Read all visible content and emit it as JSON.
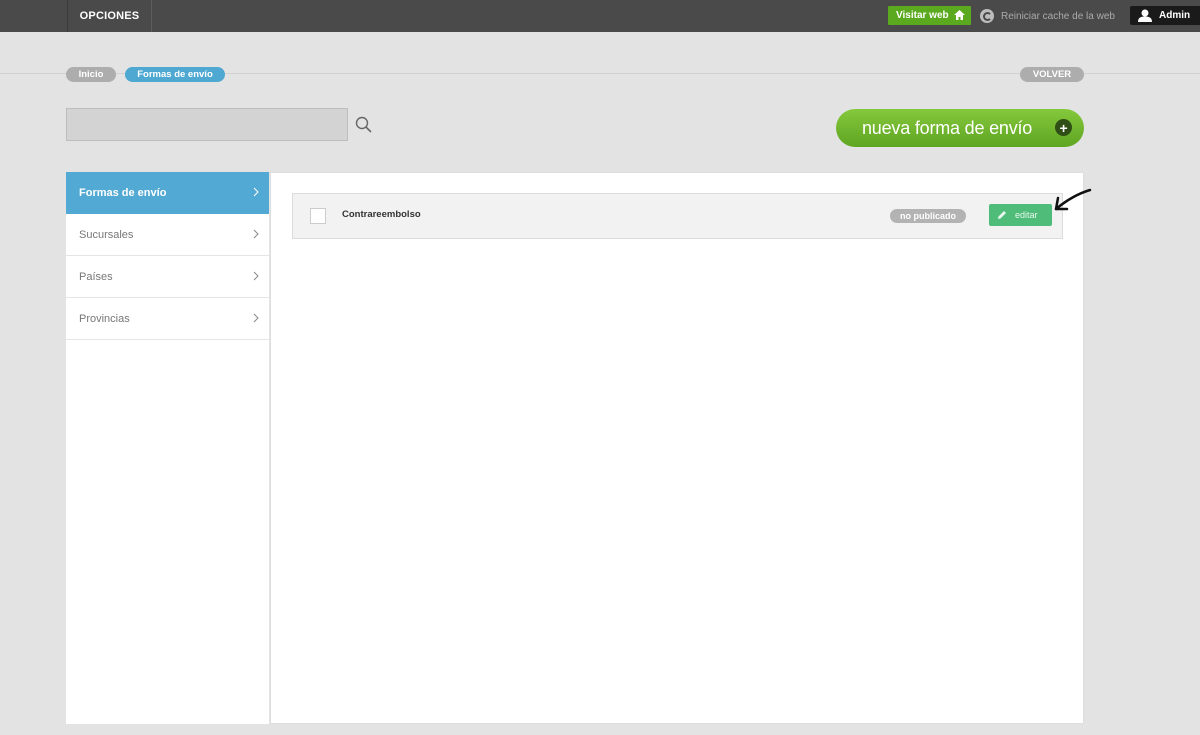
{
  "topbar": {
    "menu_label": "OPCIONES",
    "visit_label": "Visitar web",
    "cache_label": "Reiniciar cache de la web",
    "user_label": "Admin"
  },
  "breadcrumb": {
    "items": [
      "Inicio",
      "Formas de envío"
    ],
    "back_label": "VOLVER"
  },
  "search": {
    "value": "",
    "placeholder": ""
  },
  "new_button_label": "nueva forma de envío",
  "sidebar": {
    "items": [
      {
        "label": "Formas de envío",
        "active": true
      },
      {
        "label": "Sucursales",
        "active": false
      },
      {
        "label": "Países",
        "active": false
      },
      {
        "label": "Provincias",
        "active": false
      }
    ]
  },
  "list": {
    "rows": [
      {
        "name": "Contrareembolso",
        "status": "no publicado",
        "edit_label": "editar"
      }
    ]
  },
  "colors": {
    "topbar": "#4a4a4a",
    "accent_blue": "#52a9d3",
    "accent_green": "#5ea521",
    "edit_green": "#4fbc7a"
  },
  "icons": [
    "home-icon",
    "refresh-icon",
    "user-icon",
    "search-icon",
    "plus-icon",
    "chevron-right-icon",
    "pencil-icon",
    "arrow-annotation-icon"
  ]
}
